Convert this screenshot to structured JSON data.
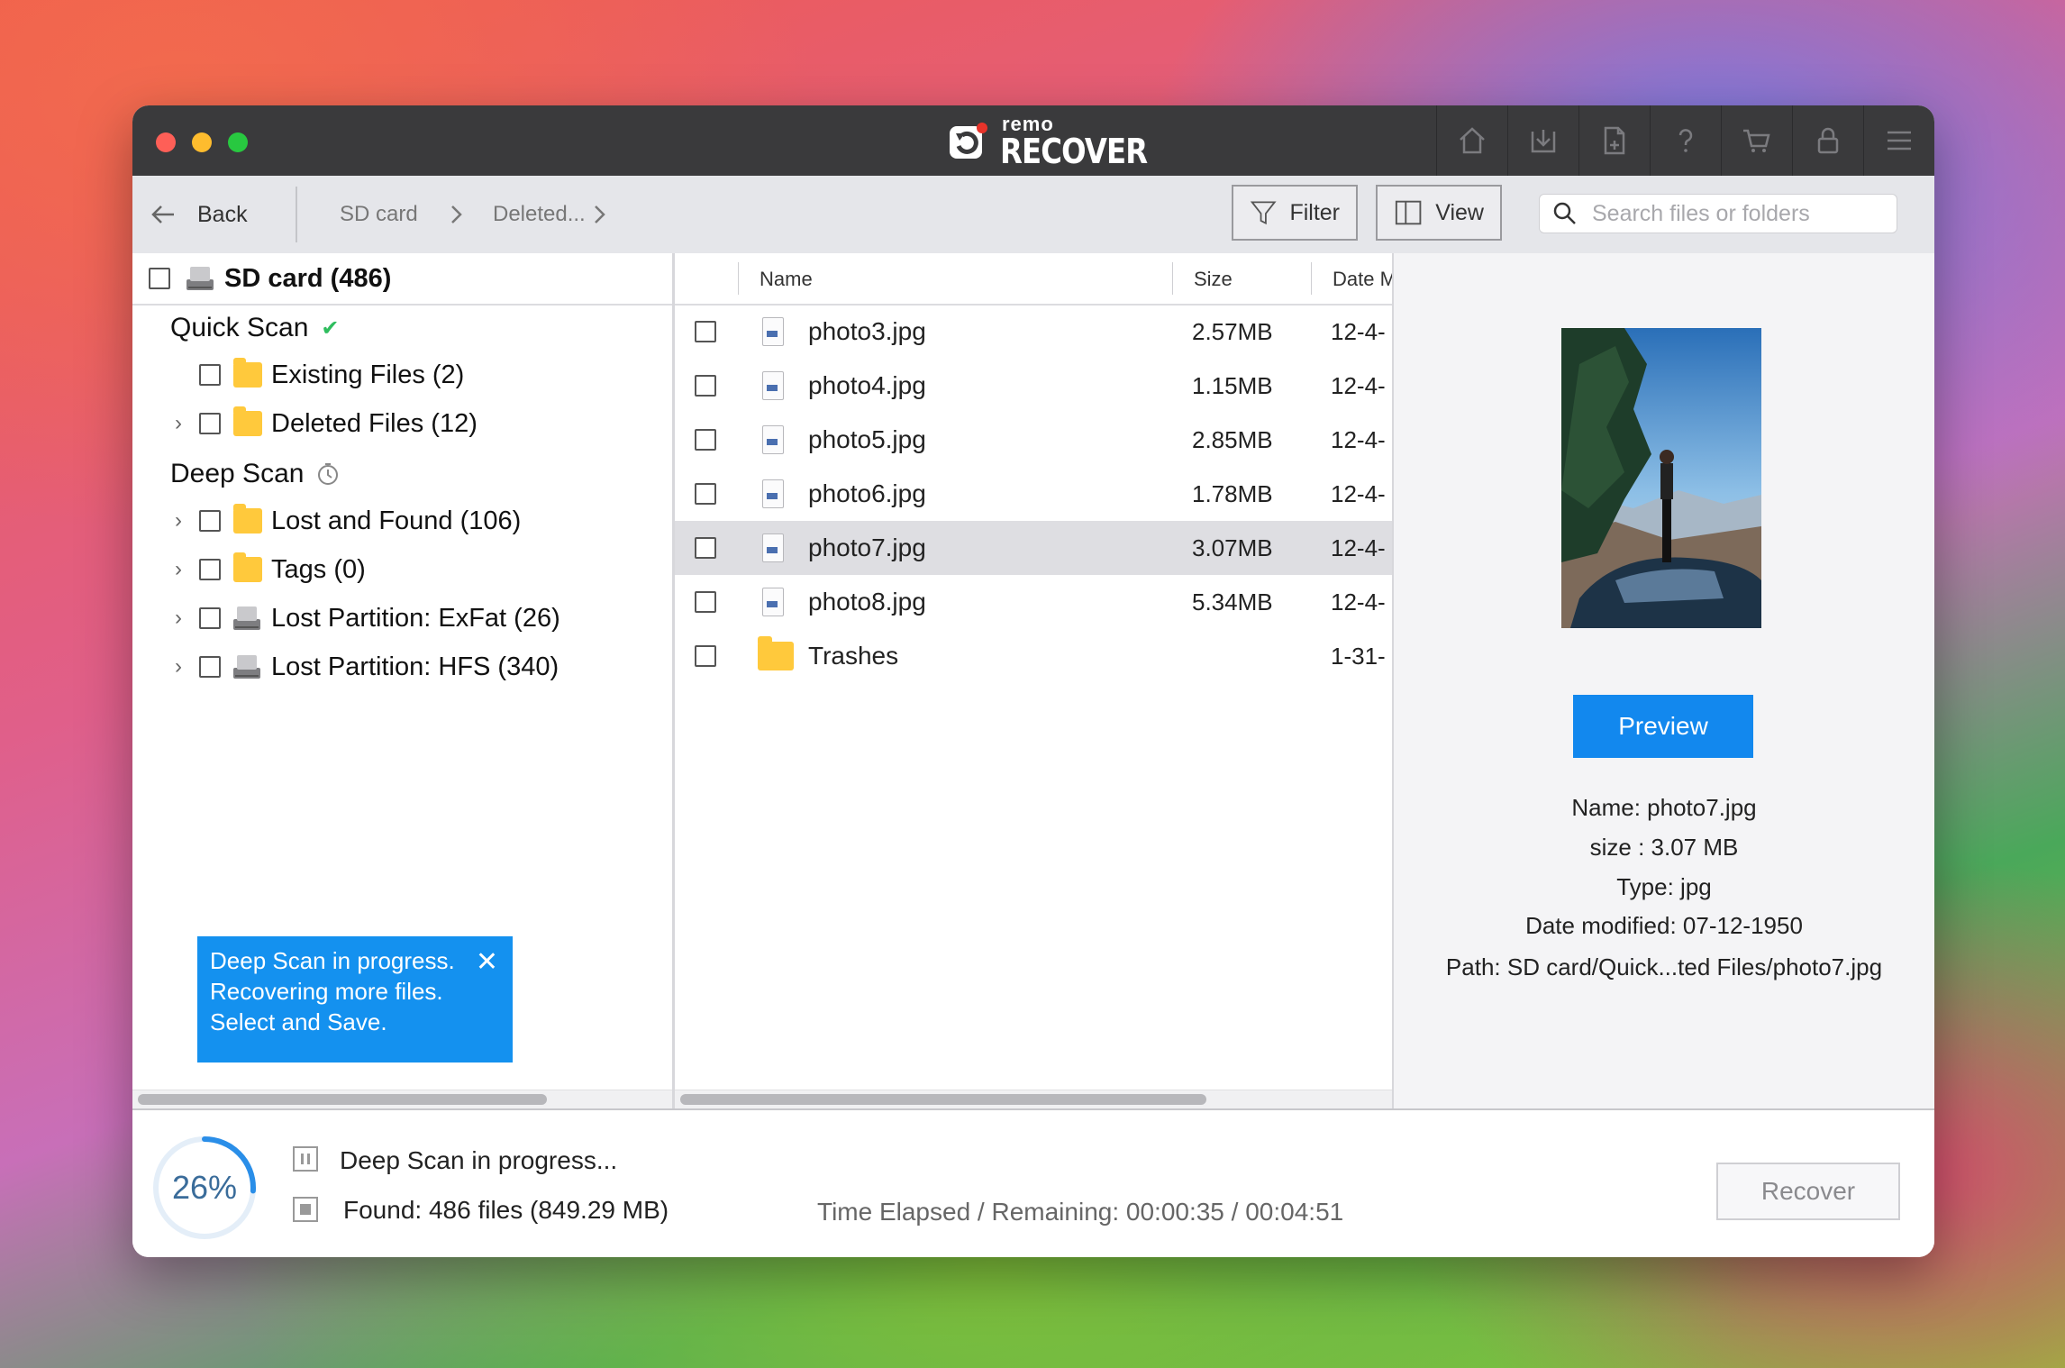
{
  "app": {
    "logo_small": "remo",
    "logo_big": "RECOVER"
  },
  "toolbar": {
    "back_label": "Back",
    "breadcrumb": [
      "SD card",
      "Deleted..."
    ],
    "filter_label": "Filter",
    "view_label": "View",
    "search_placeholder": "Search files or folders",
    "search_value": ""
  },
  "tree": {
    "root": "SD card (486)",
    "quick_scan": "Quick Scan",
    "deep_scan": "Deep Scan",
    "items": [
      {
        "label": "Existing Files (2)",
        "icon": "folder",
        "expandable": false
      },
      {
        "label": "Deleted Files (12)",
        "icon": "folder",
        "expandable": true
      },
      {
        "label": "Lost and Found (106)",
        "icon": "folder",
        "expandable": true
      },
      {
        "label": "Tags (0)",
        "icon": "folder",
        "expandable": true
      },
      {
        "label": "Lost Partition: ExFat (26)",
        "icon": "drive",
        "expandable": true
      },
      {
        "label": "Lost Partition: HFS (340)",
        "icon": "drive",
        "expandable": true
      }
    ]
  },
  "toast": {
    "line1": "Deep Scan in progress.",
    "line2": "Recovering more files.",
    "line3": "Select and Save.",
    "close": "✕"
  },
  "files": {
    "headers": {
      "name": "Name",
      "size": "Size",
      "date": "Date M"
    },
    "rows": [
      {
        "name": "photo3.jpg",
        "size": "2.57MB",
        "date": "12-4-",
        "type": "file"
      },
      {
        "name": "photo4.jpg",
        "size": "1.15MB",
        "date": "12-4-",
        "type": "file"
      },
      {
        "name": "photo5.jpg",
        "size": "2.85MB",
        "date": "12-4-",
        "type": "file"
      },
      {
        "name": "photo6.jpg",
        "size": "1.78MB",
        "date": "12-4-",
        "type": "file"
      },
      {
        "name": "photo7.jpg",
        "size": "3.07MB",
        "date": "12-4-",
        "type": "file",
        "selected": true
      },
      {
        "name": "photo8.jpg",
        "size": "5.34MB",
        "date": "12-4-",
        "type": "file"
      },
      {
        "name": "Trashes",
        "size": "",
        "date": "1-31-",
        "type": "folder"
      }
    ]
  },
  "details": {
    "preview_label": "Preview",
    "name": "Name: photo7.jpg",
    "size": "size : 3.07 MB",
    "type": "Type: jpg",
    "modified": "Date modified: 07-12-1950",
    "path": "Path: SD card/Quick...ted Files/photo7.jpg"
  },
  "status": {
    "progress_percent": 26,
    "progress_label": "26%",
    "line1": "Deep Scan in progress...",
    "line2": "Found: 486 files (849.29 MB)",
    "time": "Time Elapsed / Remaining: 00:00:35 / 00:04:51",
    "recover_label": "Recover"
  },
  "colors": {
    "accent": "#1288ee",
    "titlebar": "#3a3a3c",
    "close": "#fe5f57",
    "minimize": "#febc2e",
    "maximize": "#28c840"
  }
}
